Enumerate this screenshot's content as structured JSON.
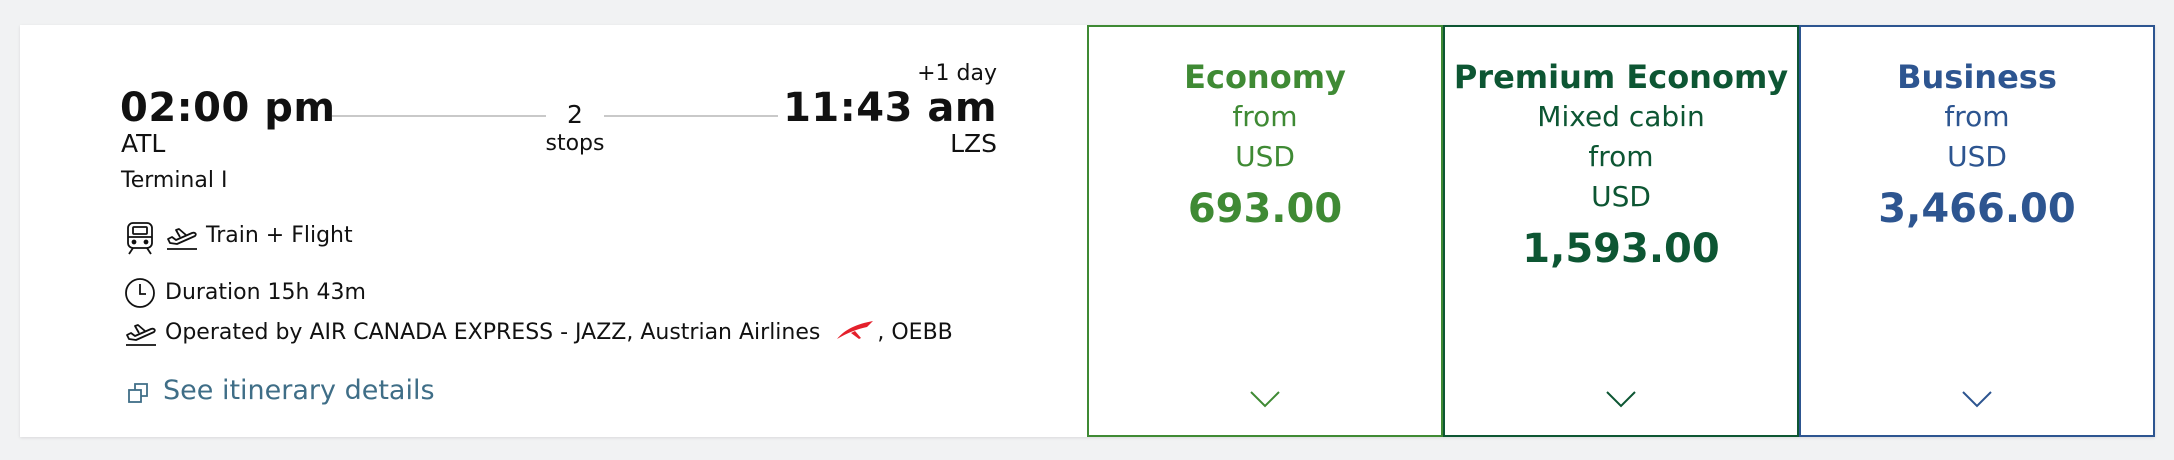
{
  "flight": {
    "depart_time": "02:00 pm",
    "depart_airport": "ATL",
    "depart_terminal": "Terminal I",
    "stops_count": "2",
    "stops_label": "stops",
    "day_offset": "+1 day",
    "arrive_time": "11:43 am",
    "arrive_airport": "LZS",
    "transport_mode": "Train + Flight",
    "duration": "Duration 15h 43m",
    "operated_by_prefix": "Operated by AIR CANADA EXPRESS - JAZZ, Austrian Airlines",
    "operated_by_suffix": ", OEBB",
    "itinerary_link": "See itinerary details"
  },
  "fares": [
    {
      "cabin": "Economy",
      "line1": "from",
      "line2": "USD",
      "line3": "",
      "price": "693.00",
      "color": "#3f8a34"
    },
    {
      "cabin": "Premium Economy",
      "line1": "Mixed cabin",
      "line2": "from",
      "line3": "USD",
      "price": "1,593.00",
      "color": "#0d5633"
    },
    {
      "cabin": "Business",
      "line1": "from",
      "line2": "USD",
      "line3": "",
      "price": "3,466.00",
      "color": "#2d5590"
    }
  ],
  "icons": {
    "train": "train-icon",
    "plane": "plane-departure-icon",
    "clock": "clock-icon",
    "airline_logo": "austrian-airlines-logo",
    "external": "open-details-icon",
    "chevron": "chevron-down-icon"
  },
  "colors": {
    "economy": "#3f8a34",
    "premium_economy": "#0d5633",
    "business": "#2d5590",
    "link": "#3f6e87",
    "austrian_red": "#e4202b"
  }
}
